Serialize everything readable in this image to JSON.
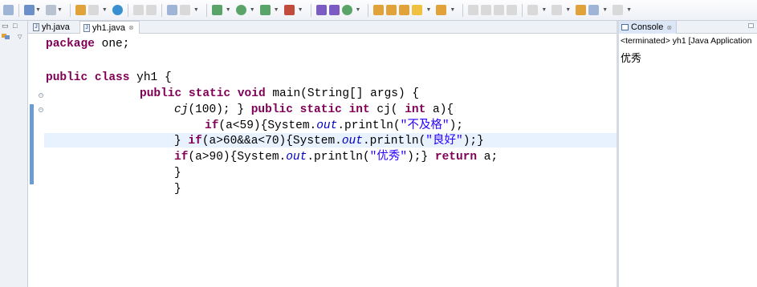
{
  "toolbar": {
    "icons": [
      "new-icon",
      "save-icon",
      "print-icon",
      "run-icon",
      "debug-icon",
      "search-icon",
      "open-type-icon",
      "build-icon",
      "external-tools-icon",
      "navigate-back-icon",
      "navigate-forward-icon"
    ]
  },
  "editor": {
    "tabs": [
      {
        "label": "yh.java",
        "active": false
      },
      {
        "label": "yh1.java",
        "active": true,
        "close": "⊗"
      }
    ],
    "code": {
      "l1": {
        "kw": "package",
        "rest": " one;"
      },
      "l2": {
        "kw1": "public",
        "kw2": "class",
        "rest": " yh1 {"
      },
      "l3": {
        "kw1": "public",
        "kw2": "static",
        "kw3": "void",
        "rest": " main(String[] args) {"
      },
      "l4": {
        "call": "cj",
        "a": "(100); } ",
        "kw1": "public",
        "kw2": "static",
        "kw3": "int",
        "b": " cj( ",
        "kw4": "int",
        "c": " a){"
      },
      "l5": {
        "kw": "if",
        "a": "(a<59){System.",
        "fld": "out",
        "b": ".println(",
        "str": "\"不及格\"",
        "c": ");"
      },
      "l6": {
        "a": "} ",
        "kw": "if",
        "b": "(a>60&&a<70){System.",
        "fld": "out",
        "c": ".println(",
        "str": "\"良好\"",
        "d": ");}"
      },
      "l7": {
        "kw": "if",
        "a": "(a>90){System.",
        "fld": "out",
        "b": ".println(",
        "str": "\"优秀\"",
        "c": ");} ",
        "kw2": "return",
        "d": " a;"
      },
      "l8": "}",
      "l9": "}"
    }
  },
  "console": {
    "tab_label": "Console",
    "tab_close": "⊗",
    "status": "<terminated> yh1 [Java Application",
    "output": "优秀"
  },
  "colors": {
    "keyword": "#7f0055",
    "string": "#2a00ff",
    "field": "#0000c0",
    "current_line": "#e8f2fe"
  }
}
